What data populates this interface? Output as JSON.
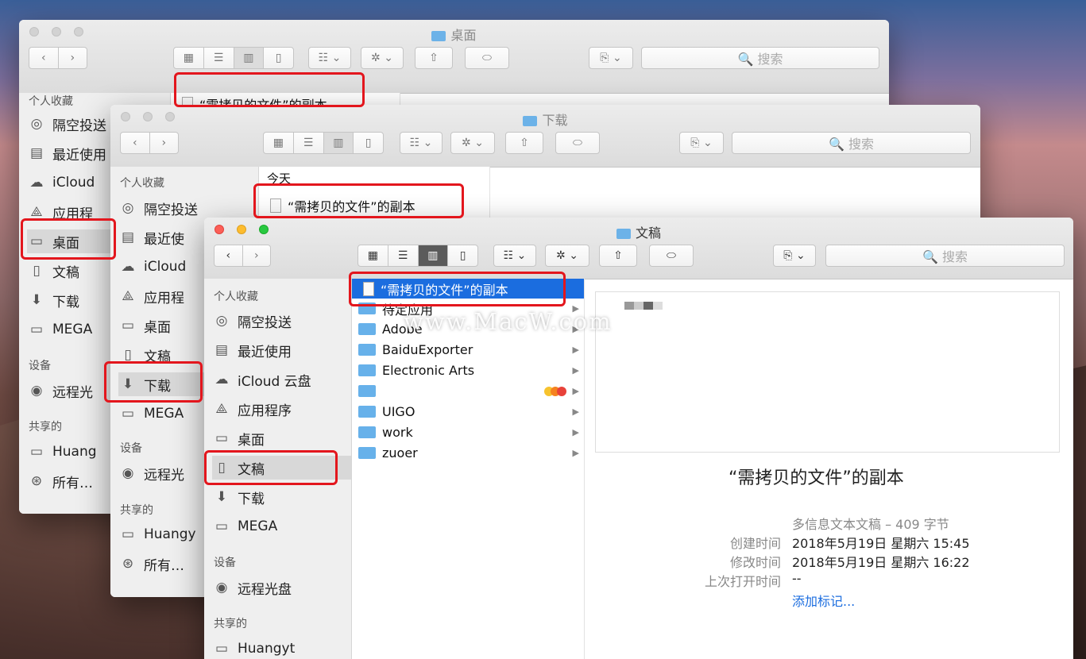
{
  "colors": {
    "accent": "#1b6ddf",
    "folder": "#67b1ea",
    "highlight": "#e3161d"
  },
  "toolbar": {
    "gear": "✲ ⌄",
    "share": "⇧",
    "tag": "⬭",
    "action": "⎘ ⌄",
    "search": "🔍 搜索",
    "back": "‹",
    "forward": "›",
    "arrange": "☷ ⌄"
  },
  "window1": {
    "title": "桌面",
    "file": "“需拷贝的文件”的副本",
    "sidebar": {
      "favorites": "个人收藏",
      "items": [
        "隔空投送",
        "最近使用",
        "iCloud",
        "应用程",
        "桌面",
        "文稿",
        "下载",
        "MEGA"
      ],
      "devices": "设备",
      "device_items": [
        "远程光"
      ],
      "shared": "共享的",
      "shared_items": [
        "Huang",
        "所有…"
      ]
    }
  },
  "window2": {
    "title": "下载",
    "section": "今天",
    "file": "“需拷贝的文件”的副本",
    "sidebar": {
      "favorites": "个人收藏",
      "items": [
        "隔空投送",
        "最近使",
        "iCloud",
        "应用程",
        "桌面",
        "文稿",
        "下载",
        "MEGA"
      ],
      "devices": "设备",
      "device_items": [
        "远程光"
      ],
      "shared": "共享的",
      "shared_items": [
        "Huangy",
        "所有…"
      ]
    }
  },
  "window3": {
    "title": "文稿",
    "sidebar": {
      "favorites": "个人收藏",
      "items": [
        "隔空投送",
        "最近使用",
        "iCloud 云盘",
        "应用程序",
        "桌面",
        "文稿",
        "下载",
        "MEGA"
      ],
      "devices": "设备",
      "device_items": [
        "远程光盘"
      ],
      "shared": "共享的",
      "shared_items": [
        "Huangyt"
      ]
    },
    "files": [
      "“需拷贝的文件”的副本",
      "待定应用",
      "Adobe",
      "BaiduExporter",
      "Electronic Arts",
      "",
      "UIGO",
      "work",
      "zuoer"
    ],
    "preview": {
      "name": "“需拷贝的文件”的副本",
      "kind": "多信息文本文稿 – 409 字节",
      "created_label": "创建时间",
      "created": "2018年5月19日 星期六 15:45",
      "modified_label": "修改时间",
      "modified": "2018年5月19日 星期六 16:22",
      "opened_label": "上次打开时间",
      "opened": "--",
      "add_tags": "添加标记..."
    }
  },
  "watermark": "www.MacW.com"
}
